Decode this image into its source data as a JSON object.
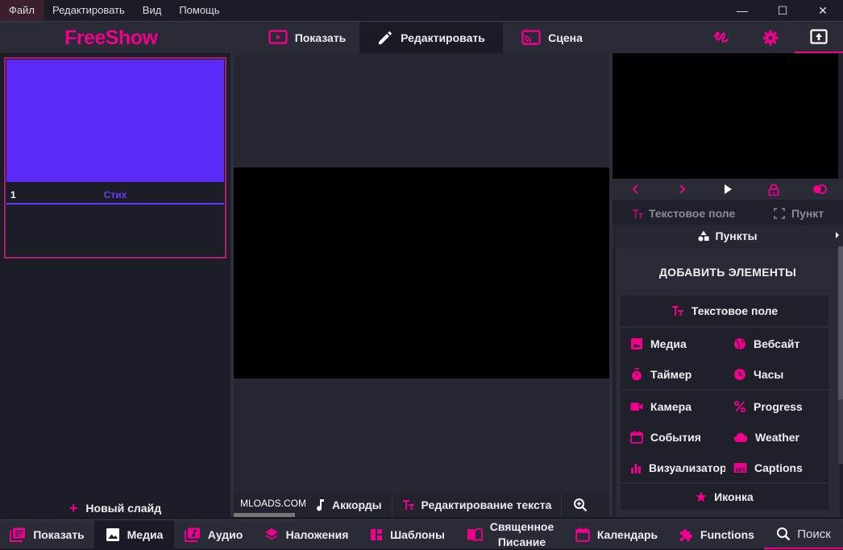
{
  "menu": [
    "Файл",
    "Редактировать",
    "Вид",
    "Помощь"
  ],
  "window_controls": {
    "minimize": "—",
    "maximize": "☐",
    "close": "✕"
  },
  "app": {
    "logo": "FreeShow"
  },
  "top_tabs": [
    {
      "label": "Показать",
      "icon": "show-icon"
    },
    {
      "label": "Редактировать",
      "icon": "pencil-icon"
    },
    {
      "label": "Сцена",
      "icon": "cast-icon"
    }
  ],
  "top_tabs_active": "Редактировать",
  "top_right_icons": [
    "draw-icon",
    "settings-gear-icon",
    "output-screen-icon"
  ],
  "slides": [
    {
      "number": "1",
      "label": "Стих",
      "color": "#5b2bf5"
    }
  ],
  "left": {
    "new_slide": "Новый слайд"
  },
  "editor_toolbar": {
    "watermark": "MLOADS.COM",
    "chords": "Аккорды",
    "text_edit": "Редактирование текста"
  },
  "right": {
    "text_field_tab": "Текстовое поле",
    "item_tab": "Пункт",
    "items_header": "Пункты",
    "add_title": "ДОБАВИТЬ ЭЛЕМЕНТЫ",
    "text_field": "Текстовое поле",
    "items": [
      {
        "label": "Медиа",
        "icon": "image-icon"
      },
      {
        "label": "Вебсайт",
        "icon": "globe-icon"
      },
      {
        "label": "Таймер",
        "icon": "timer-icon"
      },
      {
        "label": "Часы",
        "icon": "clock-icon"
      },
      {
        "label": "Камера",
        "icon": "camera-icon"
      },
      {
        "label": "Progress",
        "icon": "percent-icon"
      },
      {
        "label": "События",
        "icon": "calendar-icon"
      },
      {
        "label": "Weather",
        "icon": "cloud-icon"
      },
      {
        "label": "Визуализатор",
        "icon": "chart-icon"
      },
      {
        "label": "Captions",
        "icon": "captions-icon"
      }
    ],
    "icon_item": "Иконка"
  },
  "bottom_tabs": [
    {
      "label": "Показать",
      "icon": "shows-icon"
    },
    {
      "label": "Медиа",
      "icon": "media-icon"
    },
    {
      "label": "Аудио",
      "icon": "audio-icon"
    },
    {
      "label": "Наложения",
      "icon": "layers-icon"
    },
    {
      "label": "Шаблоны",
      "icon": "templates-icon"
    },
    {
      "label": "Священное Писание",
      "line1": "Священное",
      "line2": "Писание",
      "icon": "book-icon"
    },
    {
      "label": "Календарь",
      "icon": "calendar-icon"
    },
    {
      "label": "Functions",
      "icon": "puzzle-icon"
    }
  ],
  "bottom_active": "Медиа",
  "search": {
    "label": "Поиск"
  },
  "colors": {
    "accent": "#f0008c",
    "slide_bg": "#5b2bf5",
    "panel": "#292b36",
    "background": "#1a1b24"
  }
}
